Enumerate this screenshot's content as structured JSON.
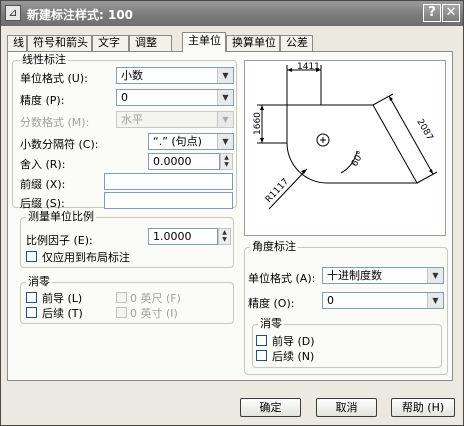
{
  "window": {
    "title": "新建标注样式: 100",
    "help_glyph": "?",
    "close_glyph": "✕"
  },
  "tabs": [
    {
      "label": "线",
      "active": false
    },
    {
      "label": "符号和箭头",
      "active": false
    },
    {
      "label": "文字",
      "active": false
    },
    {
      "label": "调整",
      "active": false
    },
    {
      "label": "主单位",
      "active": true
    },
    {
      "label": "换算单位",
      "active": false
    },
    {
      "label": "公差",
      "active": false
    }
  ],
  "linear": {
    "group_label": "线性标注",
    "unit_format": {
      "label": "单位格式 (U):",
      "value": "小数"
    },
    "precision": {
      "label": "精度 (P):",
      "value": "0"
    },
    "fraction_format": {
      "label": "分数格式 (M):",
      "value": "水平"
    },
    "decimal_separator": {
      "label": "小数分隔符 (C):",
      "value": "“.” (句点)"
    },
    "round_off": {
      "label": "舍入 (R):",
      "value": "0.0000"
    },
    "prefix": {
      "label": "前缀 (X):",
      "value": ""
    },
    "suffix": {
      "label": "后缀 (S):",
      "value": ""
    }
  },
  "scale": {
    "group_label": "测量单位比例",
    "factor_label": "比例因子 (E):",
    "factor_value": "1.0000",
    "layout_only_label": "仅应用到布局标注",
    "layout_only_checked": false
  },
  "zero_linear": {
    "group_label": "消零",
    "leading_label": "前导 (L)",
    "trailing_label": "后续 (T)",
    "feet_label": "0 英尺 (F)",
    "inches_label": "0 英寸 (I)"
  },
  "angular": {
    "group_label": "角度标注",
    "unit_format": {
      "label": "单位格式 (A):",
      "value": "十进制度数"
    },
    "precision": {
      "label": "精度 (O):",
      "value": "0"
    },
    "zero_group_label": "消零",
    "leading_label": "前导 (D)",
    "trailing_label": "后续 (N)"
  },
  "preview": {
    "dim_top": "1411",
    "dim_left": "1660",
    "dim_right": "2087",
    "dim_angle": "60°",
    "dim_radius": "R1117"
  },
  "buttons": {
    "ok": "确定",
    "cancel": "取消",
    "help": "帮助 (H)"
  },
  "dropdown_arrow": "▼",
  "spin_up": "▲",
  "spin_down": "▼"
}
